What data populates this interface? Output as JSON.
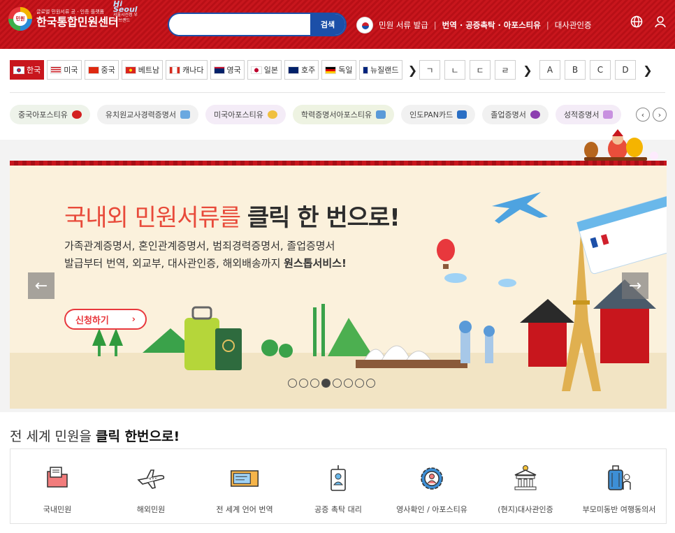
{
  "header": {
    "logo_sub": "글로벌 민원서류 공 · 인증 플랫폼",
    "logo_title": "한국통합민원센터",
    "logo_mark": "민원",
    "badge_script": "Hi Seoul",
    "badge_text": "서울시선정 우수 브랜드",
    "search_placeholder": "",
    "search_button": "검색",
    "links": [
      "민원 서류 발급",
      "번역 · 공증촉탁 · 아포스티유",
      "대사관인증"
    ],
    "icons": [
      "globe-icon",
      "user-icon"
    ]
  },
  "countries": [
    {
      "label": "한국",
      "flag": "kr",
      "active": true
    },
    {
      "label": "미국",
      "flag": "us"
    },
    {
      "label": "중국",
      "flag": "cn"
    },
    {
      "label": "베트남",
      "flag": "vn"
    },
    {
      "label": "캐나다",
      "flag": "ca"
    },
    {
      "label": "영국",
      "flag": "uk"
    },
    {
      "label": "일본",
      "flag": "jp"
    },
    {
      "label": "호주",
      "flag": "au"
    },
    {
      "label": "독일",
      "flag": "de"
    },
    {
      "label": "뉴질랜드",
      "flag": "nz"
    }
  ],
  "korean_letters": [
    "ㄱ",
    "ㄴ",
    "ㄷ",
    "ㄹ"
  ],
  "english_letters": [
    "A",
    "B",
    "C",
    "D"
  ],
  "doc_pills": [
    {
      "label": "중국아포스티유",
      "bg": "#eef3ea",
      "icon": "#d32020"
    },
    {
      "label": "유치원교사경력증명서",
      "bg": "#f1f1f1",
      "icon": "#6aa8e0"
    },
    {
      "label": "미국아포스티유",
      "bg": "#f4ecf7",
      "icon": "#f0c040"
    },
    {
      "label": "학력증명서아포스티유",
      "bg": "#eef3e2",
      "icon": "#5a9ad8"
    },
    {
      "label": "인도PAN카드",
      "bg": "#f1f1f1",
      "icon": "#2a6fc4"
    },
    {
      "label": "졸업증명서",
      "bg": "#f1f1f1",
      "icon": "#8c3fb0"
    },
    {
      "label": "성적증명서",
      "bg": "#f4ecf7",
      "icon": "#c890e0"
    }
  ],
  "banner": {
    "headline_colored": "국내외 민원서류를 ",
    "headline_bold": "클릭 한 번으로!",
    "sub_line1": "가족관계증명서, 혼인관계증명서, 범죄경력증명서, 졸업증명서",
    "sub_line2": "발급부터 번역, 외교부, 대사관인증, 해외배송까지 ",
    "sub_line2_bold": "원스톱서비스!",
    "apply_label": "신청하기",
    "apply_arrow": "›",
    "prev": "←",
    "next": "→",
    "dots": 8,
    "active_dot": 3
  },
  "section": {
    "title_plain": "전 세계 민원을 ",
    "title_bold": "클릭 한번으로!",
    "services": [
      {
        "label": "국내민원",
        "icon": "folder-icon"
      },
      {
        "label": "해외민원",
        "icon": "airplane-icon"
      },
      {
        "label": "전 세계 언어 번역",
        "icon": "ticket-icon"
      },
      {
        "label": "공증 촉탁 대리",
        "icon": "id-badge-icon"
      },
      {
        "label": "영사확인 / 아포스티유",
        "icon": "gear-person-icon"
      },
      {
        "label": "(현지)대사관인증",
        "icon": "embassy-icon"
      },
      {
        "label": "부모미동반 여행동의서",
        "icon": "traveler-icon"
      }
    ]
  }
}
